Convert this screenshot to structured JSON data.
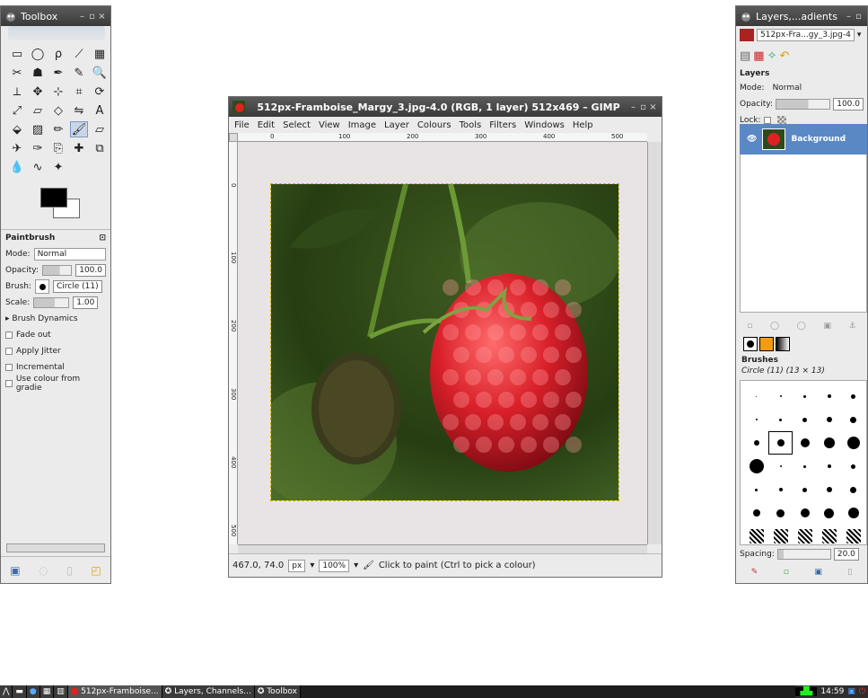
{
  "toolbox": {
    "title": "Toolbox",
    "icons": [
      "rect-select-icon",
      "ellipse-select-icon",
      "lasso-icon",
      "fuzzy-select-icon",
      "color-select-icon",
      "scissors-icon",
      "foreground-select-icon",
      "paths-icon",
      "color-picker-icon",
      "zoom-icon",
      "measure-icon",
      "move-icon",
      "align-icon",
      "crop-icon",
      "rotate-icon",
      "scale-icon",
      "shear-icon",
      "perspective-icon",
      "flip-icon",
      "text-icon",
      "bucket-fill-icon",
      "blend-icon",
      "pencil-icon",
      "paintbrush-icon",
      "eraser-icon",
      "airbrush-icon",
      "ink-icon",
      "clone-icon",
      "heal-icon",
      "perspective-clone-icon",
      "blur-icon",
      "smudge-icon",
      "dodge-icon"
    ],
    "options": {
      "title": "Paintbrush",
      "mode_label": "Mode:",
      "mode_value": "Normal",
      "opacity_label": "Opacity:",
      "opacity_value": "100.0",
      "brush_label": "Brush:",
      "brush_value": "Circle (11)",
      "scale_label": "Scale:",
      "scale_value": "1.00",
      "dynamics": "Brush Dynamics",
      "fade": "Fade out",
      "jitter": "Apply Jitter",
      "incremental": "Incremental",
      "gradient": "Use colour from gradie"
    }
  },
  "image_window": {
    "title": "512px-Framboise_Margy_3.jpg-4.0 (RGB, 1 layer) 512x469 – GIMP",
    "menu": [
      "File",
      "Edit",
      "Select",
      "View",
      "Image",
      "Layer",
      "Colours",
      "Tools",
      "Filters",
      "Windows",
      "Help"
    ],
    "ruler_h": [
      "0",
      "100",
      "200",
      "300",
      "400",
      "500"
    ],
    "ruler_v": [
      "0",
      "100",
      "200",
      "300",
      "400",
      "500"
    ],
    "status": {
      "coords": "467.0, 74.0",
      "unit": "px",
      "zoom": "100%",
      "message": "Click to paint (Ctrl to pick a colour)"
    }
  },
  "dock": {
    "title": "Layers,...adients",
    "image_select": "512px-Fra...gy_3.jpg-4",
    "layers_title": "Layers",
    "mode_label": "Mode:",
    "mode_value": "Normal",
    "opacity_label": "Opacity:",
    "opacity_value": "100.0",
    "lock_label": "Lock:",
    "layer_name": "Background",
    "brushes_title": "Brushes",
    "brush_name": "Circle (11) (13 × 13)",
    "spacing_label": "Spacing:",
    "spacing_value": "20.0"
  },
  "taskbar": {
    "tasks": [
      "512px-Framboise...",
      "Layers, Channels...",
      "Toolbox"
    ],
    "clock": "14:59"
  },
  "colors": {
    "selection": "#5a88c5",
    "titlebar": "#3a3a3a",
    "foreground": "#000000",
    "background": "#ffffff"
  }
}
